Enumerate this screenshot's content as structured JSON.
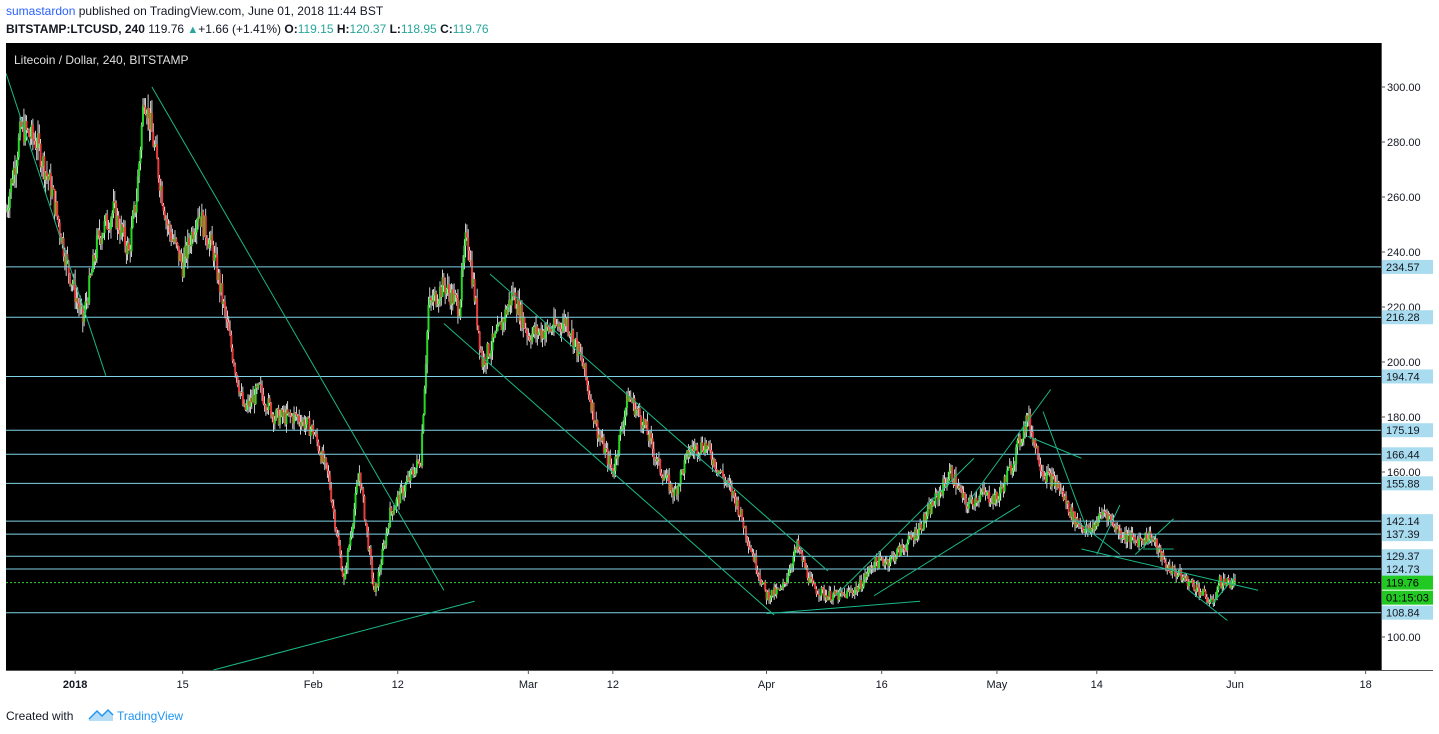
{
  "header": {
    "author": "sumastardon",
    "published_text": "published on TradingView.com, June 01, 2018 11:44 BST",
    "symbol": "BITSTAMP:LTCUSD, 240",
    "last": "119.76",
    "change": "+1.66 (+1.41%)",
    "o_label": "O:",
    "o_value": "119.15",
    "h_label": "H:",
    "h_value": "120.37",
    "l_label": "L:",
    "l_value": "118.95",
    "c_label": "C:",
    "c_value": "119.76"
  },
  "footer": {
    "created": "Created with",
    "brand": "TradingView"
  },
  "colors": {
    "background": "#000000",
    "up": "#26d926",
    "down": "#e83b3b",
    "wick": "#ffffff",
    "hline": "#7fd4e6",
    "trend": "#19b889",
    "price_line": "#38d238"
  },
  "chart_data": {
    "type": "candlestick",
    "title": "Litecoin / Dollar, 240, BITSTAMP",
    "ylim": [
      88,
      316
    ],
    "y_ticks": [
      100,
      120,
      140,
      160,
      180,
      200,
      220,
      240,
      260,
      280,
      300
    ],
    "y_tick_labels": [
      "100.00",
      "120.00",
      "140.00",
      "160.00",
      "180.00",
      "200.00",
      "220.00",
      "240.00",
      "260.00",
      "280.00",
      "300.00"
    ],
    "x_range": [
      "2017-12-23",
      "2018-06-20"
    ],
    "x_ticks": [
      {
        "date": "2018-01-01",
        "label": "2018"
      },
      {
        "date": "2018-01-15",
        "label": "15"
      },
      {
        "date": "2018-02-01",
        "label": "Feb"
      },
      {
        "date": "2018-02-12",
        "label": "12"
      },
      {
        "date": "2018-03-01",
        "label": "Mar"
      },
      {
        "date": "2018-03-12",
        "label": "12"
      },
      {
        "date": "2018-04-01",
        "label": "Apr"
      },
      {
        "date": "2018-04-16",
        "label": "16"
      },
      {
        "date": "2018-05-01",
        "label": "May"
      },
      {
        "date": "2018-05-14",
        "label": "14"
      },
      {
        "date": "2018-06-01",
        "label": "Jun"
      },
      {
        "date": "2018-06-18",
        "label": "18"
      }
    ],
    "horizontal_levels": [
      234.57,
      216.28,
      194.74,
      175.19,
      166.44,
      155.88,
      142.14,
      137.39,
      129.37,
      124.73,
      108.84
    ],
    "horizontal_level_labels": [
      "234.57",
      "216.28",
      "194.74",
      "175.19",
      "166.44",
      "155.88",
      "142.14",
      "137.39",
      "129.37",
      "124.73",
      "108.84"
    ],
    "last_price": 119.76,
    "last_price_label": "119.76",
    "countdown_label": "01:15:03",
    "price_path": [
      [
        "2017-12-23",
        255
      ],
      [
        "2017-12-25",
        285
      ],
      [
        "2017-12-27",
        280
      ],
      [
        "2017-12-29",
        262
      ],
      [
        "2017-12-31",
        235
      ],
      [
        "2018-01-02",
        215
      ],
      [
        "2018-01-04",
        245
      ],
      [
        "2018-01-06",
        255
      ],
      [
        "2018-01-08",
        240
      ],
      [
        "2018-01-09",
        260
      ],
      [
        "2018-01-10",
        298
      ],
      [
        "2018-01-11",
        283
      ],
      [
        "2018-01-13",
        250
      ],
      [
        "2018-01-15",
        235
      ],
      [
        "2018-01-17",
        255
      ],
      [
        "2018-01-19",
        240
      ],
      [
        "2018-01-21",
        210
      ],
      [
        "2018-01-23",
        182
      ],
      [
        "2018-01-25",
        190
      ],
      [
        "2018-01-27",
        180
      ],
      [
        "2018-01-30",
        180
      ],
      [
        "2018-02-01",
        175
      ],
      [
        "2018-02-03",
        158
      ],
      [
        "2018-02-05",
        120
      ],
      [
        "2018-02-07",
        160
      ],
      [
        "2018-02-09",
        115
      ],
      [
        "2018-02-11",
        145
      ],
      [
        "2018-02-13",
        155
      ],
      [
        "2018-02-15",
        165
      ],
      [
        "2018-02-16",
        220
      ],
      [
        "2018-02-18",
        228
      ],
      [
        "2018-02-20",
        220
      ],
      [
        "2018-02-21",
        248
      ],
      [
        "2018-02-23",
        200
      ],
      [
        "2018-02-25",
        210
      ],
      [
        "2018-02-27",
        225
      ],
      [
        "2018-03-01",
        210
      ],
      [
        "2018-03-04",
        212
      ],
      [
        "2018-03-06",
        215
      ],
      [
        "2018-03-08",
        200
      ],
      [
        "2018-03-10",
        175
      ],
      [
        "2018-03-12",
        160
      ],
      [
        "2018-03-14",
        188
      ],
      [
        "2018-03-16",
        178
      ],
      [
        "2018-03-18",
        162
      ],
      [
        "2018-03-20",
        152
      ],
      [
        "2018-03-22",
        168
      ],
      [
        "2018-03-24",
        170
      ],
      [
        "2018-03-26",
        160
      ],
      [
        "2018-03-28",
        150
      ],
      [
        "2018-03-30",
        132
      ],
      [
        "2018-04-01",
        115
      ],
      [
        "2018-04-03",
        117
      ],
      [
        "2018-04-05",
        133
      ],
      [
        "2018-04-07",
        118
      ],
      [
        "2018-04-09",
        115
      ],
      [
        "2018-04-11",
        115
      ],
      [
        "2018-04-13",
        118
      ],
      [
        "2018-04-15",
        127
      ],
      [
        "2018-04-17",
        128
      ],
      [
        "2018-04-19",
        133
      ],
      [
        "2018-04-21",
        140
      ],
      [
        "2018-04-23",
        150
      ],
      [
        "2018-04-25",
        160
      ],
      [
        "2018-04-27",
        148
      ],
      [
        "2018-04-29",
        152
      ],
      [
        "2018-05-01",
        150
      ],
      [
        "2018-05-03",
        163
      ],
      [
        "2018-05-05",
        180
      ],
      [
        "2018-05-07",
        160
      ],
      [
        "2018-05-09",
        155
      ],
      [
        "2018-05-11",
        143
      ],
      [
        "2018-05-13",
        138
      ],
      [
        "2018-05-15",
        146
      ],
      [
        "2018-05-17",
        138
      ],
      [
        "2018-05-19",
        135
      ],
      [
        "2018-05-21",
        137
      ],
      [
        "2018-05-23",
        126
      ],
      [
        "2018-05-25",
        122
      ],
      [
        "2018-05-27",
        118
      ],
      [
        "2018-05-29",
        112
      ],
      [
        "2018-05-30",
        120
      ],
      [
        "2018-06-01",
        119.76
      ]
    ],
    "trend_lines": [
      {
        "from": [
          "2017-12-23",
          305
        ],
        "to": [
          "2018-01-05",
          195
        ]
      },
      {
        "from": [
          "2018-01-11",
          300
        ],
        "to": [
          "2018-02-18",
          117
        ]
      },
      {
        "from": [
          "2018-01-19",
          88
        ],
        "to": [
          "2018-02-22",
          113
        ]
      },
      {
        "from": [
          "2018-02-24",
          232
        ],
        "to": [
          "2018-04-09",
          124
        ]
      },
      {
        "from": [
          "2018-02-18",
          214
        ],
        "to": [
          "2018-04-02",
          108
        ]
      },
      {
        "from": [
          "2018-04-01",
          108.5
        ],
        "to": [
          "2018-04-21",
          113
        ]
      },
      {
        "from": [
          "2018-04-15",
          115
        ],
        "to": [
          "2018-05-04",
          148
        ]
      },
      {
        "from": [
          "2018-04-10",
          115
        ],
        "to": [
          "2018-04-28",
          165
        ]
      },
      {
        "from": [
          "2018-04-27",
          148
        ],
        "to": [
          "2018-05-08",
          190
        ]
      },
      {
        "from": [
          "2018-05-05",
          173
        ],
        "to": [
          "2018-05-12",
          165
        ]
      },
      {
        "from": [
          "2018-05-07",
          182
        ],
        "to": [
          "2018-05-13",
          137
        ]
      },
      {
        "from": [
          "2018-05-11",
          143
        ],
        "to": [
          "2018-05-17",
          130
        ]
      },
      {
        "from": [
          "2018-05-14",
          130
        ],
        "to": [
          "2018-05-17",
          148
        ]
      },
      {
        "from": [
          "2018-05-19",
          130
        ],
        "to": [
          "2018-05-24",
          143
        ]
      },
      {
        "from": [
          "2018-05-20",
          132
        ],
        "to": [
          "2018-05-24",
          132
        ]
      },
      {
        "from": [
          "2018-05-12",
          132
        ],
        "to": [
          "2018-06-04",
          117
        ]
      },
      {
        "from": [
          "2018-05-26",
          117
        ],
        "to": [
          "2018-05-31",
          106
        ]
      },
      {
        "from": [
          "2018-05-29",
          112
        ],
        "to": [
          "2018-06-01",
          122
        ]
      }
    ]
  }
}
